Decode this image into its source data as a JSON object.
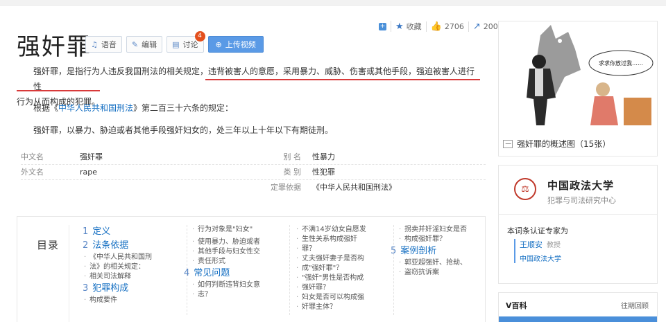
{
  "stats": {
    "add_label": "+",
    "favorite": "收藏",
    "likes": "2706",
    "shares": "200"
  },
  "title": "强奸罪",
  "buttons": {
    "voice": "语音",
    "edit": "编辑",
    "discuss": "讨论",
    "discuss_count": "4",
    "upload": "上传视频"
  },
  "summary": {
    "p1_start": "强奸罪，是指行为人违反我国刑法的相关规定，",
    "p1_highlight": "违背被害人的意愿，采用暴力、威胁、伤害或其他手段，强迫被害人进行性",
    "p1_line2": "行为从而构成的犯罪。",
    "p2_prefix": "根据《",
    "p2_link": "中华人民共和国刑法",
    "p2_suffix": "》第二百三十六条的规定：",
    "p3": "强奸罪，以暴力、胁迫或者其他手段强奸妇女的，处三年以上十年以下有期徒刑。"
  },
  "info": {
    "rows": [
      {
        "k": "中文名",
        "v": "强奸罪",
        "k2": "别    名",
        "v2": "性暴力"
      },
      {
        "k": "外文名",
        "v": "rape",
        "k2": "类    别",
        "v2": "性犯罪"
      },
      {
        "k": "",
        "v": "",
        "k2": "定罪依据",
        "v2": "《中华人民共和国刑法》"
      }
    ]
  },
  "catalog": {
    "title": "目录",
    "col1": [
      {
        "n": "1",
        "label": "定义",
        "subs": []
      },
      {
        "n": "2",
        "label": "法条依据",
        "subs": [
          "《中华人民共和国刑",
          "法》的相关规定：",
          "相关司法解释"
        ]
      },
      {
        "n": "3",
        "label": "犯罪构成",
        "subs": [
          "构成要件"
        ]
      }
    ],
    "col2_subs_a": [
      "行为对象是\"妇女\"",
      "使用暴力、胁迫或者",
      "其他手段与妇女性交",
      "责任形式"
    ],
    "col2_h": {
      "n": "4",
      "label": "常见问题"
    },
    "col2_subs_b": [
      "如何判断违背妇女意",
      "志？"
    ],
    "col3_subs": [
      "不满14岁幼女自愿发",
      "生性关系构成强奸",
      "罪？",
      "丈夫强奸妻子是否构",
      "成\"强奸罪\"？",
      "\"强奸\"男性是否构成",
      "强奸罪？",
      "妇女是否可以构成强",
      "奸罪主体？"
    ],
    "col4_subs_a": [
      "拐卖并奸淫妇女是否",
      "构成强奸罪？"
    ],
    "col4_h": {
      "n": "5",
      "label": "案例剖析"
    },
    "col4_subs_b": [
      "郭亚超强奸、抢劫、",
      "盗窃抗诉案"
    ]
  },
  "image": {
    "speech": "求求你放过我……",
    "caption": "强奸罪的概述图（15张）"
  },
  "expert": {
    "org": "中国政法大学",
    "org_sub": "犯罪与司法研究中心",
    "label": "本词条认证专家为",
    "name": "王顺安",
    "title": "教授",
    "affiliation": "中国政法大学"
  },
  "vbaike": {
    "title": "V百科",
    "more": "往期回顾"
  }
}
